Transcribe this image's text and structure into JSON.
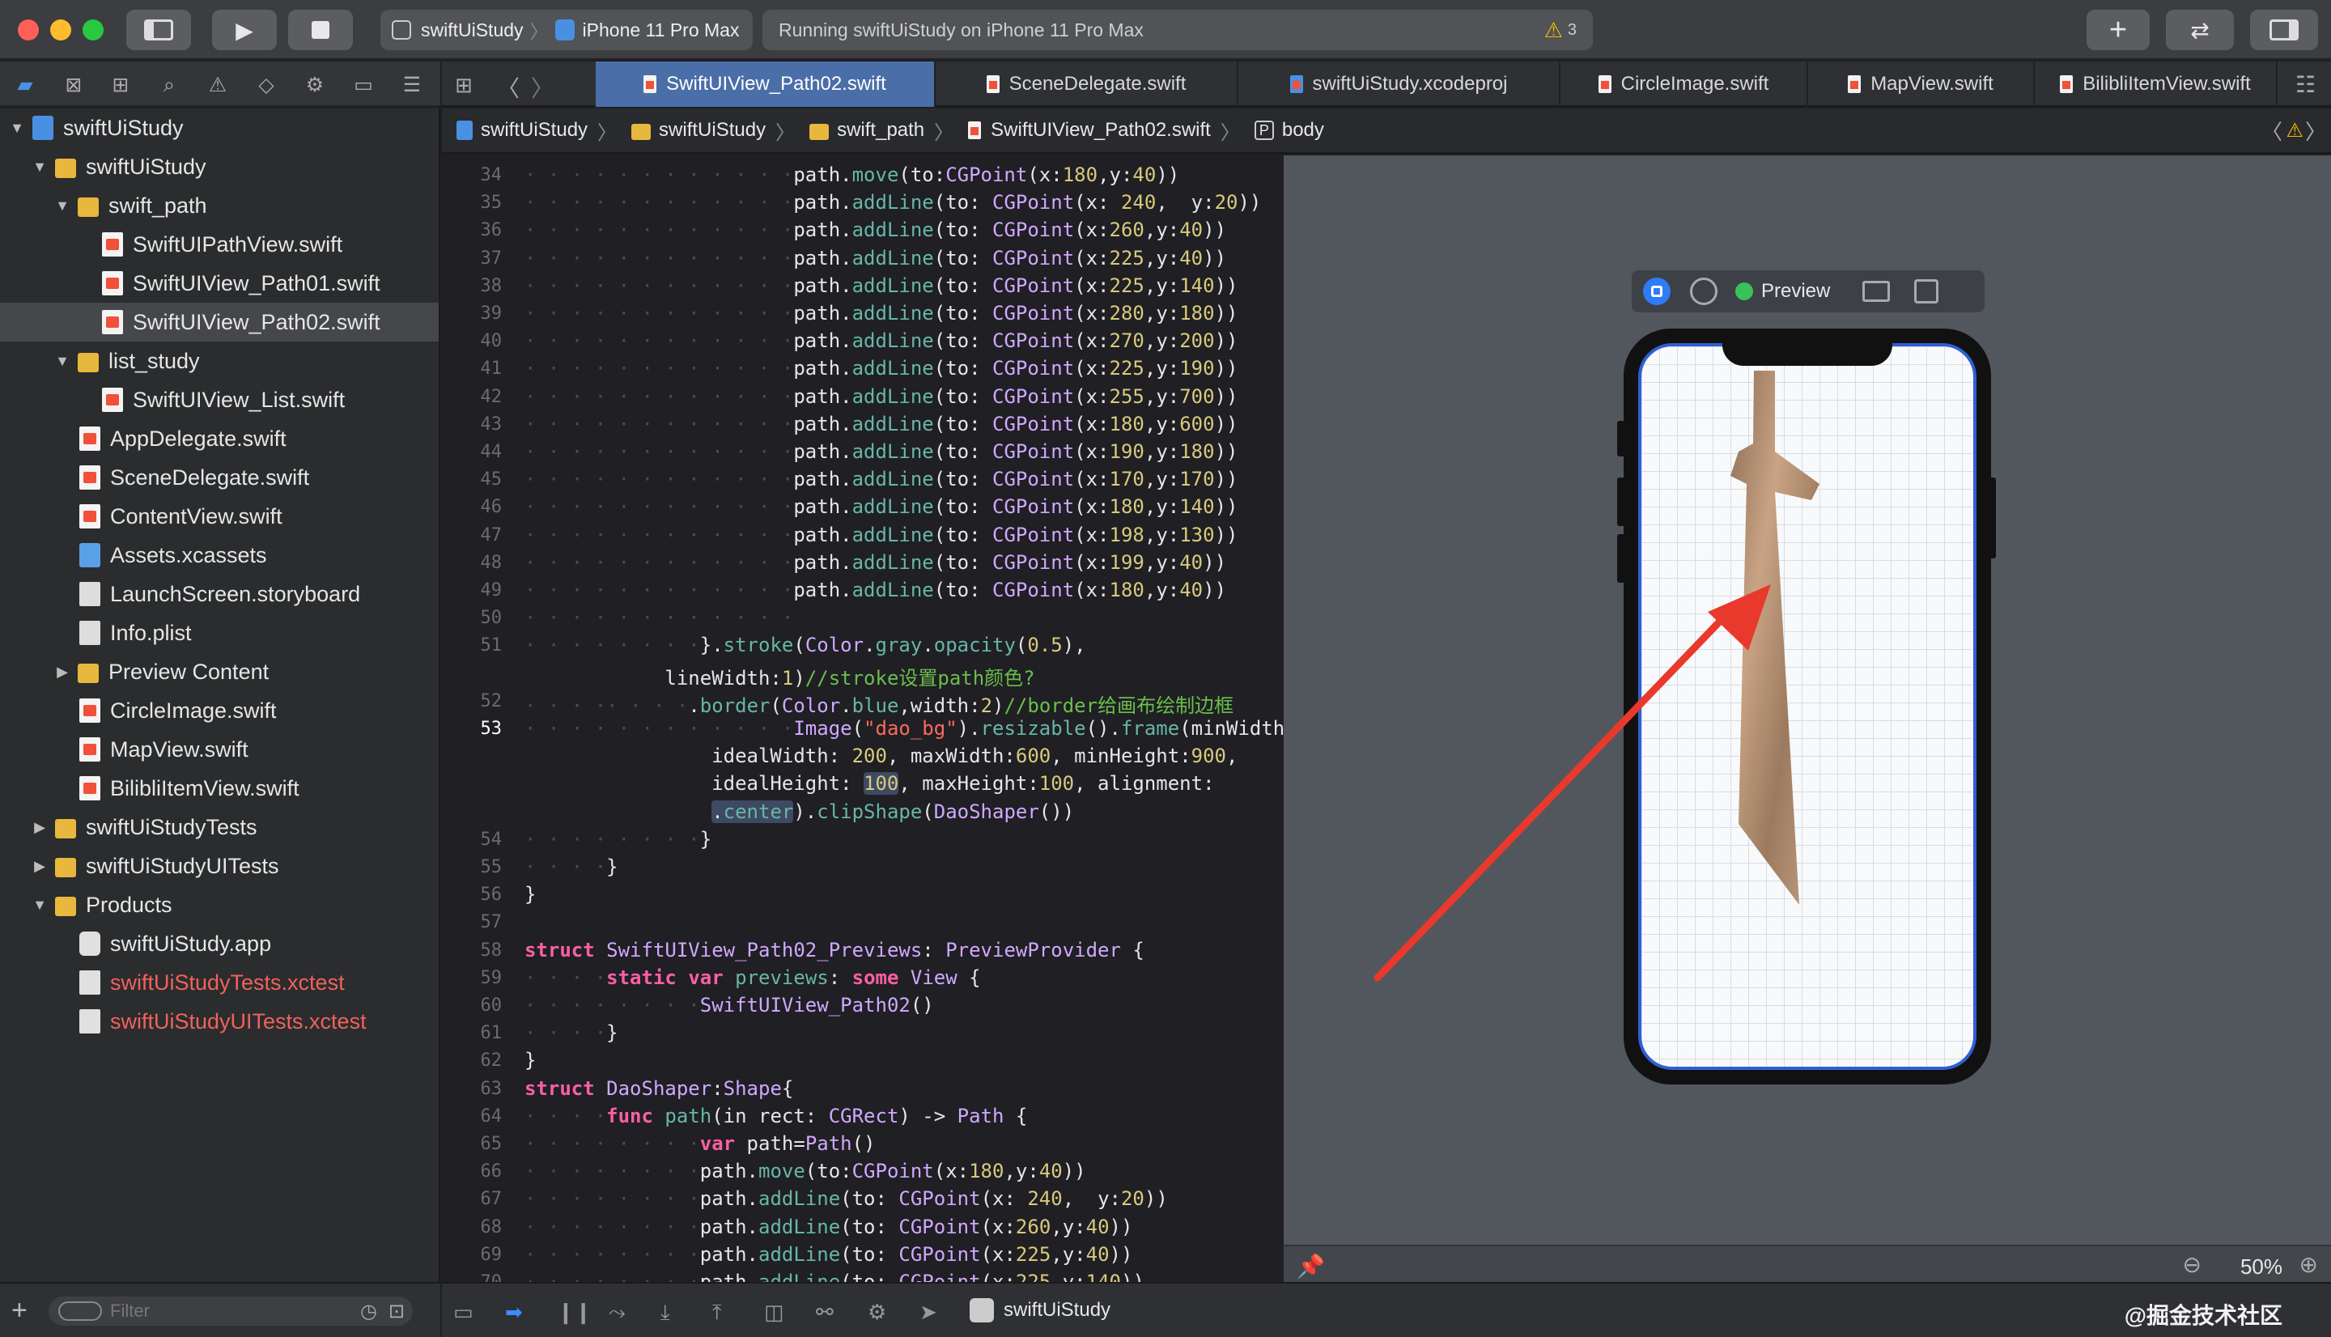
{
  "toolbar": {
    "scheme": "swiftUiStudy",
    "device": "iPhone 11 Pro Max",
    "status": "Running swiftUiStudy on iPhone 11 Pro Max",
    "warning_count": "3",
    "colors": {
      "close": "#ff5f57",
      "minimize": "#febc2e",
      "zoom": "#28c840"
    }
  },
  "tabs": [
    "SwiftUIView_Path02.swift",
    "SceneDelegate.swift",
    "swiftUiStudy.xcodeproj",
    "CircleImage.swift",
    "MapView.swift",
    "BilibliItemView.swift"
  ],
  "breadcrumb": {
    "c1": "swiftUiStudy",
    "c2": "swiftUiStudy",
    "c3": "swift_path",
    "c4": "SwiftUIView_Path02.swift",
    "c5_badge": "P",
    "c5": "body"
  },
  "navigator": {
    "items": [
      {
        "label": "swiftUiStudy",
        "icon": "project-icon"
      },
      {
        "label": "swiftUiStudy",
        "icon": "folder-icon"
      },
      {
        "label": "swift_path",
        "icon": "folder-icon"
      },
      {
        "label": "SwiftUIPathView.swift",
        "icon": "swift-file-icon"
      },
      {
        "label": "SwiftUIView_Path01.swift",
        "icon": "swift-file-icon"
      },
      {
        "label": "SwiftUIView_Path02.swift",
        "icon": "swift-file-icon"
      },
      {
        "label": "list_study",
        "icon": "folder-icon"
      },
      {
        "label": "SwiftUIView_List.swift",
        "icon": "swift-file-icon"
      },
      {
        "label": "AppDelegate.swift",
        "icon": "swift-file-icon"
      },
      {
        "label": "SceneDelegate.swift",
        "icon": "swift-file-icon"
      },
      {
        "label": "ContentView.swift",
        "icon": "swift-file-icon"
      },
      {
        "label": "Assets.xcassets",
        "icon": "asset-catalog-icon"
      },
      {
        "label": "LaunchScreen.storyboard",
        "icon": "storyboard-icon"
      },
      {
        "label": "Info.plist",
        "icon": "plist-icon"
      },
      {
        "label": "Preview Content",
        "icon": "folder-icon"
      },
      {
        "label": "CircleImage.swift",
        "icon": "swift-file-icon"
      },
      {
        "label": "MapView.swift",
        "icon": "swift-file-icon"
      },
      {
        "label": "BilibliItemView.swift",
        "icon": "swift-file-icon"
      },
      {
        "label": "swiftUiStudyTests",
        "icon": "folder-icon"
      },
      {
        "label": "swiftUiStudyUITests",
        "icon": "folder-icon"
      },
      {
        "label": "Products",
        "icon": "folder-icon"
      },
      {
        "label": "swiftUiStudy.app",
        "icon": "app-icon"
      },
      {
        "label": "swiftUiStudyTests.xctest",
        "icon": "xctest-icon"
      },
      {
        "label": "swiftUiStudyUITests.xctest",
        "icon": "xctest-icon"
      }
    ],
    "filter_placeholder": "Filter"
  },
  "editor": {
    "line_numbers": [
      "34",
      "35",
      "36",
      "37",
      "38",
      "39",
      "40",
      "41",
      "42",
      "43",
      "44",
      "45",
      "46",
      "47",
      "48",
      "49",
      "50",
      "51",
      "",
      "52",
      "53",
      "",
      "",
      "",
      "54",
      "55",
      "56",
      "57",
      "58",
      "59",
      "60",
      "61",
      "62",
      "63",
      "64",
      "65",
      "66",
      "67",
      "68",
      "69",
      "70"
    ],
    "current_line": "53"
  },
  "preview": {
    "label": "Preview",
    "zoom": "50%",
    "accent": "#2e5fd6"
  },
  "debug": {
    "target": "swiftUiStudy"
  },
  "watermark": "@掘金技术社区"
}
